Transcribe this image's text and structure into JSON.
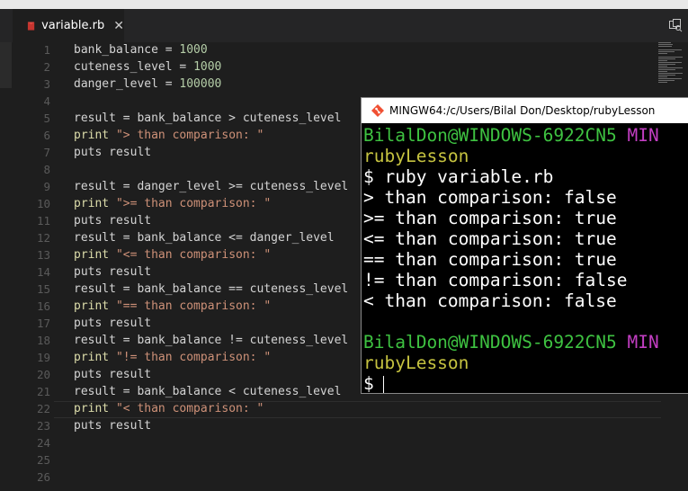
{
  "tab": {
    "label": "variable.rb",
    "close": "✕"
  },
  "line_numbers": [
    "1",
    "2",
    "3",
    "4",
    "5",
    "6",
    "7",
    "8",
    "9",
    "10",
    "11",
    "12",
    "13",
    "14",
    "15",
    "16",
    "17",
    "18",
    "19",
    "20",
    "21",
    "22",
    "23",
    "24",
    "25",
    "26"
  ],
  "code": {
    "l1": {
      "a": "bank_balance = ",
      "b": "1000"
    },
    "l2": {
      "a": "cuteness_level = ",
      "b": "1000"
    },
    "l3": {
      "a": "danger_level = ",
      "b": "100000"
    },
    "l5": "result = bank_balance > cuteness_level",
    "l6": {
      "a": "print ",
      "b": "\"> than comparison: \""
    },
    "l7": "puts result",
    "l9": "result = danger_level >= cuteness_level",
    "l10": {
      "a": "print ",
      "b": "\">= than comparison: \""
    },
    "l11": "puts result",
    "l12": "result = bank_balance <= danger_level",
    "l13": {
      "a": "print ",
      "b": "\"<= than comparison: \""
    },
    "l14": "puts result",
    "l15": "result = bank_balance == cuteness_level",
    "l16": {
      "a": "print ",
      "b": "\"== than comparison: \""
    },
    "l17": "puts result",
    "l18": "result = bank_balance != cuteness_level",
    "l19": {
      "a": "print ",
      "b": "\"!= than comparison: \""
    },
    "l20": "puts result",
    "l21": "result = bank_balance < cuteness_level",
    "l22": {
      "a": "print ",
      "b": "\"< than comparison: \""
    },
    "l23": "puts result"
  },
  "terminal": {
    "title": "MINGW64:/c/Users/Bilal Don/Desktop/rubyLesson",
    "prompt_user": "BilalDon@WINDOWS-6922CN5",
    "prompt_env": "MIN",
    "prompt_dir": "rubyLesson",
    "command": "$ ruby variable.rb",
    "out1": "> than comparison: false",
    "out2": ">= than comparison: true",
    "out3": "<= than comparison: true",
    "out4": "== than comparison: true",
    "out5": "!= than comparison: false",
    "out6": "< than comparison: false",
    "prompt_symbol": "$"
  },
  "icons": {
    "tab": "ruby-file-icon",
    "split": "split-editor-icon",
    "terminal": "git-bash-icon"
  },
  "colors": {
    "editor_bg": "#1e1e1e",
    "terminal_bg": "#000000",
    "prompt_green": "#3ec241",
    "prompt_magenta": "#c23ec2",
    "prompt_yellow": "#c6c340",
    "number": "#b5cea8",
    "string": "#ce9178"
  }
}
